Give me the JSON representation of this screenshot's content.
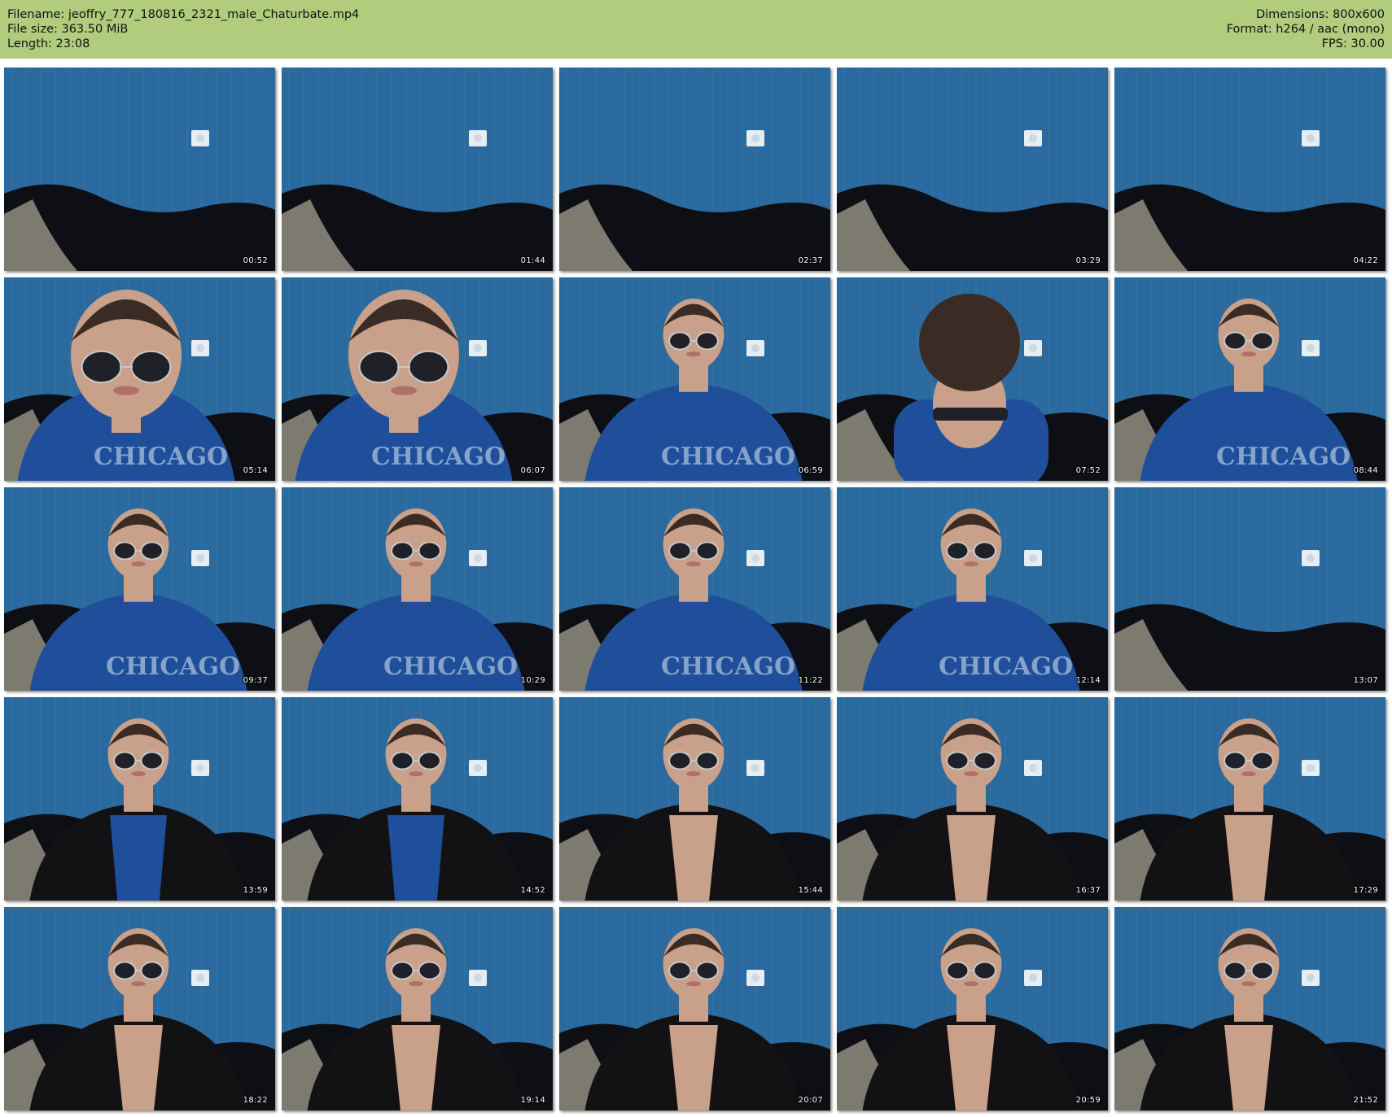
{
  "info": {
    "filename_label": "Filename:",
    "filename": "jeoffry_777_180816_2321_male_Chaturbate.mp4",
    "filesize_label": "File size:",
    "filesize": "363.50 MiB",
    "length_label": "Length:",
    "length": "23:08",
    "dimensions_label": "Dimensions:",
    "dimensions": "800x600",
    "format_label": "Format:",
    "format": "h264 / aac (mono)",
    "fps_label": "FPS:",
    "fps": "30.00"
  },
  "colors": {
    "header_bg": "#b0cc7c",
    "wall": "#2a6a9e",
    "sofa": "#0d0f14",
    "pillow": "#7d7b70",
    "shirt": "#1f4f9a",
    "jacket": "#121214",
    "skin": "#c9a08a",
    "hair": "#3a2c24",
    "glasses": "#202028"
  },
  "frames": [
    {
      "time": "00:52",
      "scene": "empty"
    },
    {
      "time": "01:44",
      "scene": "empty"
    },
    {
      "time": "02:37",
      "scene": "empty"
    },
    {
      "time": "03:29",
      "scene": "empty"
    },
    {
      "time": "04:22",
      "scene": "empty"
    },
    {
      "time": "05:14",
      "scene": "closeup-shirt"
    },
    {
      "time": "06:07",
      "scene": "closeup-shirt"
    },
    {
      "time": "06:59",
      "scene": "shirt"
    },
    {
      "time": "07:52",
      "scene": "head-down"
    },
    {
      "time": "08:44",
      "scene": "shirt"
    },
    {
      "time": "09:37",
      "scene": "shirt"
    },
    {
      "time": "10:29",
      "scene": "shirt"
    },
    {
      "time": "11:22",
      "scene": "shirt"
    },
    {
      "time": "12:14",
      "scene": "shirt"
    },
    {
      "time": "13:07",
      "scene": "empty"
    },
    {
      "time": "13:59",
      "scene": "jacket-shirt"
    },
    {
      "time": "14:52",
      "scene": "jacket-shirt"
    },
    {
      "time": "15:44",
      "scene": "jacket-chest"
    },
    {
      "time": "16:37",
      "scene": "jacket-chest"
    },
    {
      "time": "17:29",
      "scene": "jacket-chest"
    },
    {
      "time": "18:22",
      "scene": "jacket-chest"
    },
    {
      "time": "19:14",
      "scene": "jacket-chest"
    },
    {
      "time": "20:07",
      "scene": "jacket-chest"
    },
    {
      "time": "20:59",
      "scene": "jacket-chest"
    },
    {
      "time": "21:52",
      "scene": "jacket-chest"
    }
  ]
}
